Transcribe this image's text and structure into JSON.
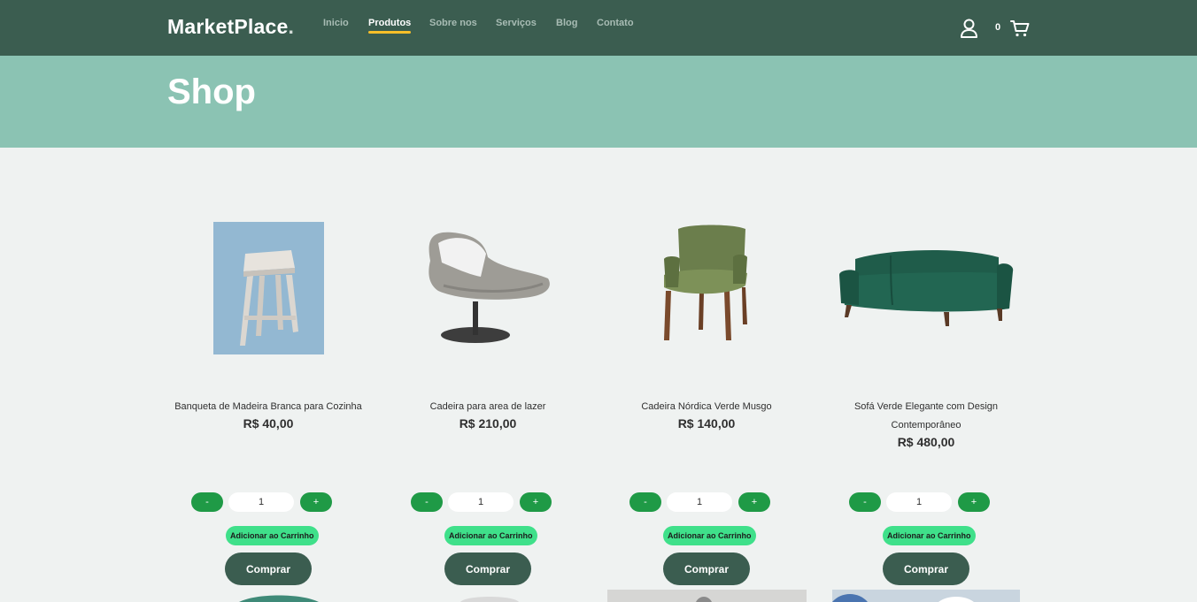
{
  "brand": {
    "name": "MarketPlace",
    "dot": "."
  },
  "nav": {
    "items": [
      {
        "label": "Inicio",
        "active": false
      },
      {
        "label": "Produtos",
        "active": true
      },
      {
        "label": "Sobre nos",
        "active": false
      },
      {
        "label": "Serviços",
        "active": false
      },
      {
        "label": "Blog",
        "active": false
      },
      {
        "label": "Contato",
        "active": false
      }
    ]
  },
  "cart": {
    "count": "0"
  },
  "hero": {
    "title": "Shop"
  },
  "products": [
    {
      "name": "Banqueta de Madeira Branca para Cozinha",
      "price": "R$ 40,00",
      "quantity": "1",
      "decrement_label": "-",
      "increment_label": "+",
      "add_to_cart_label": "Adicionar ao Carrinho",
      "buy_label": "Comprar",
      "image_icon": "wooden-stool"
    },
    {
      "name": "Cadeira para area de lazer",
      "price": "R$ 210,00",
      "quantity": "1",
      "decrement_label": "-",
      "increment_label": "+",
      "add_to_cart_label": "Adicionar ao Carrinho",
      "buy_label": "Comprar",
      "image_icon": "lounge-chair"
    },
    {
      "name": "Cadeira Nórdica Verde Musgo",
      "price": "R$ 140,00",
      "quantity": "1",
      "decrement_label": "-",
      "increment_label": "+",
      "add_to_cart_label": "Adicionar ao Carrinho",
      "buy_label": "Comprar",
      "image_icon": "green-armchair"
    },
    {
      "name": "Sofá Verde Elegante com Design Contemporâneo",
      "price": "R$ 480,00",
      "quantity": "1",
      "decrement_label": "-",
      "increment_label": "+",
      "add_to_cart_label": "Adicionar ao Carrinho",
      "buy_label": "Comprar",
      "image_icon": "green-sofa"
    }
  ],
  "colors": {
    "navbar": "#3b5d50",
    "hero": "#8bc3b3",
    "page_background": "#eff2f1",
    "nav_active_underline": "#f9bf29",
    "qty_button": "#1f9a46",
    "add_to_cart_button": "#3fe08a",
    "buy_button": "#3b5d50"
  }
}
